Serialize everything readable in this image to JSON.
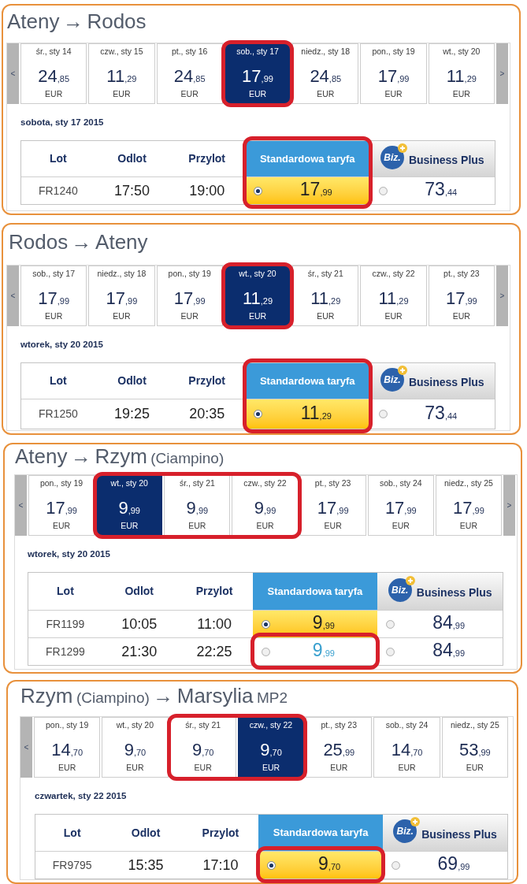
{
  "sections": [
    {
      "title": [
        {
          "text": "Ateny",
          "kind": "main"
        },
        {
          "text": "→",
          "kind": "main"
        },
        {
          "text": "Rodos",
          "kind": "main"
        }
      ],
      "date_strip": {
        "prev": "<",
        "next": ">",
        "dates": [
          {
            "label": "śr., sty 14",
            "whole": "24",
            "decimals": ",85",
            "currency": "EUR",
            "selected": false,
            "circled": false
          },
          {
            "label": "czw., sty 15",
            "whole": "11",
            "decimals": ",29",
            "currency": "EUR",
            "selected": false,
            "circled": false
          },
          {
            "label": "pt., sty 16",
            "whole": "24",
            "decimals": ",85",
            "currency": "EUR",
            "selected": false,
            "circled": false
          },
          {
            "label": "sob., sty 17",
            "whole": "17",
            "decimals": ",99",
            "currency": "EUR",
            "selected": true,
            "circled": true
          },
          {
            "label": "niedz., sty 18",
            "whole": "24",
            "decimals": ",85",
            "currency": "EUR",
            "selected": false,
            "circled": false
          },
          {
            "label": "pon., sty 19",
            "whole": "17",
            "decimals": ",99",
            "currency": "EUR",
            "selected": false,
            "circled": false
          },
          {
            "label": "wt., sty 20",
            "whole": "11",
            "decimals": ",29",
            "currency": "EUR",
            "selected": false,
            "circled": false
          }
        ]
      },
      "date_heading": "sobota, sty 17 2015",
      "table": {
        "columns": [
          {
            "label": "Lot",
            "kind": "plain",
            "circled": false
          },
          {
            "label": "Odlot",
            "kind": "plain",
            "circled": false
          },
          {
            "label": "Przylot",
            "kind": "plain",
            "circled": false
          },
          {
            "label": "Standardowa taryfa",
            "kind": "standard",
            "circled": true
          },
          {
            "label": "Business Plus",
            "kind": "business",
            "logo": "Biz.",
            "circled": false
          }
        ],
        "rows": [
          {
            "flight": "FR1240",
            "departure": "17:50",
            "arrival": "19:00",
            "fares": [
              {
                "whole": "17",
                "decimals": ",99",
                "selected": true,
                "hover": false,
                "circled": false
              },
              {
                "whole": "73",
                "decimals": ",44",
                "selected": false,
                "hover": false,
                "circled": false
              }
            ]
          }
        ]
      }
    },
    {
      "title": [
        {
          "text": "Rodos",
          "kind": "main"
        },
        {
          "text": "→",
          "kind": "main"
        },
        {
          "text": "Ateny",
          "kind": "main"
        }
      ],
      "date_strip": {
        "prev": "<",
        "next": ">",
        "dates": [
          {
            "label": "sob., sty 17",
            "whole": "17",
            "decimals": ",99",
            "currency": "EUR",
            "selected": false,
            "circled": false
          },
          {
            "label": "niedz., sty 18",
            "whole": "17",
            "decimals": ",99",
            "currency": "EUR",
            "selected": false,
            "circled": false
          },
          {
            "label": "pon., sty 19",
            "whole": "17",
            "decimals": ",99",
            "currency": "EUR",
            "selected": false,
            "circled": false
          },
          {
            "label": "wt., sty 20",
            "whole": "11",
            "decimals": ",29",
            "currency": "EUR",
            "selected": true,
            "circled": true
          },
          {
            "label": "śr., sty 21",
            "whole": "11",
            "decimals": ",29",
            "currency": "EUR",
            "selected": false,
            "circled": false
          },
          {
            "label": "czw., sty 22",
            "whole": "11",
            "decimals": ",29",
            "currency": "EUR",
            "selected": false,
            "circled": false
          },
          {
            "label": "pt., sty 23",
            "whole": "17",
            "decimals": ",99",
            "currency": "EUR",
            "selected": false,
            "circled": false
          }
        ]
      },
      "date_heading": "wtorek, sty 20 2015",
      "table": {
        "columns": [
          {
            "label": "Lot",
            "kind": "plain",
            "circled": false
          },
          {
            "label": "Odlot",
            "kind": "plain",
            "circled": false
          },
          {
            "label": "Przylot",
            "kind": "plain",
            "circled": false
          },
          {
            "label": "Standardowa taryfa",
            "kind": "standard",
            "circled": true
          },
          {
            "label": "Business Plus",
            "kind": "business",
            "logo": "Biz.",
            "circled": false
          }
        ],
        "rows": [
          {
            "flight": "FR1250",
            "departure": "19:25",
            "arrival": "20:35",
            "fares": [
              {
                "whole": "11",
                "decimals": ",29",
                "selected": true,
                "hover": false,
                "circled": false
              },
              {
                "whole": "73",
                "decimals": ",44",
                "selected": false,
                "hover": false,
                "circled": false
              }
            ]
          }
        ]
      }
    },
    {
      "title": [
        {
          "text": "Ateny",
          "kind": "main"
        },
        {
          "text": "→",
          "kind": "main"
        },
        {
          "text": "Rzym",
          "kind": "main"
        },
        {
          "text": "(Ciampino)",
          "kind": "note"
        }
      ],
      "date_strip": {
        "prev": "<",
        "next": ">",
        "dates": [
          {
            "label": "pon., sty 19",
            "whole": "17",
            "decimals": ",99",
            "currency": "EUR",
            "selected": false,
            "circled": false
          },
          {
            "label": "wt., sty 20",
            "whole": "9",
            "decimals": ",99",
            "currency": "EUR",
            "selected": true,
            "circled": true
          },
          {
            "label": "śr., sty 21",
            "whole": "9",
            "decimals": ",99",
            "currency": "EUR",
            "selected": false,
            "circled": true
          },
          {
            "label": "czw., sty 22",
            "whole": "9",
            "decimals": ",99",
            "currency": "EUR",
            "selected": false,
            "circled": true
          },
          {
            "label": "pt., sty 23",
            "whole": "17",
            "decimals": ",99",
            "currency": "EUR",
            "selected": false,
            "circled": false
          },
          {
            "label": "sob., sty 24",
            "whole": "17",
            "decimals": ",99",
            "currency": "EUR",
            "selected": false,
            "circled": false
          },
          {
            "label": "niedz., sty 25",
            "whole": "17",
            "decimals": ",99",
            "currency": "EUR",
            "selected": false,
            "circled": false
          }
        ]
      },
      "date_heading": "wtorek, sty 20 2015",
      "table": {
        "columns": [
          {
            "label": "Lot",
            "kind": "plain",
            "circled": false
          },
          {
            "label": "Odlot",
            "kind": "plain",
            "circled": false
          },
          {
            "label": "Przylot",
            "kind": "plain",
            "circled": false
          },
          {
            "label": "Standardowa taryfa",
            "kind": "standard",
            "circled": false
          },
          {
            "label": "Business Plus",
            "kind": "business",
            "logo": "Biz.",
            "circled": false
          }
        ],
        "rows": [
          {
            "flight": "FR1199",
            "departure": "10:05",
            "arrival": "11:00",
            "fares": [
              {
                "whole": "9",
                "decimals": ",99",
                "selected": true,
                "hover": false,
                "circled": false
              },
              {
                "whole": "84",
                "decimals": ",99",
                "selected": false,
                "hover": false,
                "circled": false
              }
            ]
          },
          {
            "flight": "FR1299",
            "departure": "21:30",
            "arrival": "22:25",
            "fares": [
              {
                "whole": "9",
                "decimals": ",99",
                "selected": false,
                "hover": true,
                "circled": true
              },
              {
                "whole": "84",
                "decimals": ",99",
                "selected": false,
                "hover": false,
                "circled": false
              }
            ]
          }
        ]
      }
    },
    {
      "title": [
        {
          "text": "Rzym",
          "kind": "main"
        },
        {
          "text": "(Ciampino)",
          "kind": "note"
        },
        {
          "text": "→",
          "kind": "main"
        },
        {
          "text": "Marsylia",
          "kind": "main"
        },
        {
          "text": "MP2",
          "kind": "note"
        }
      ],
      "date_strip": {
        "prev": "<",
        "dates": [
          {
            "label": "pon., sty 19",
            "whole": "14",
            "decimals": ",70",
            "currency": "EUR",
            "selected": false,
            "circled": false
          },
          {
            "label": "wt., sty 20",
            "whole": "9",
            "decimals": ",70",
            "currency": "EUR",
            "selected": false,
            "circled": false
          },
          {
            "label": "śr., sty 21",
            "whole": "9",
            "decimals": ",70",
            "currency": "EUR",
            "selected": false,
            "circled": true
          },
          {
            "label": "czw., sty 22",
            "whole": "9",
            "decimals": ",70",
            "currency": "EUR",
            "selected": true,
            "circled": true
          },
          {
            "label": "pt., sty 23",
            "whole": "25",
            "decimals": ",99",
            "currency": "EUR",
            "selected": false,
            "circled": false
          },
          {
            "label": "sob., sty 24",
            "whole": "14",
            "decimals": ",70",
            "currency": "EUR",
            "selected": false,
            "circled": false
          },
          {
            "label": "niedz., sty 25",
            "whole": "53",
            "decimals": ",99",
            "currency": "EUR",
            "selected": false,
            "circled": false
          }
        ]
      },
      "date_heading": "czwartek, sty 22 2015",
      "table": {
        "columns": [
          {
            "label": "Lot",
            "kind": "plain",
            "circled": false
          },
          {
            "label": "Odlot",
            "kind": "plain",
            "circled": false
          },
          {
            "label": "Przylot",
            "kind": "plain",
            "circled": false
          },
          {
            "label": "Standardowa taryfa",
            "kind": "standard",
            "circled": false
          },
          {
            "label": "Business Plus",
            "kind": "business",
            "logo": "Biz.",
            "circled": false
          }
        ],
        "rows": [
          {
            "flight": "FR9795",
            "departure": "15:35",
            "arrival": "17:10",
            "fares": [
              {
                "whole": "9",
                "decimals": ",70",
                "selected": true,
                "hover": false,
                "circled": true
              },
              {
                "whole": "69",
                "decimals": ",99",
                "selected": false,
                "hover": false,
                "circled": false
              }
            ]
          }
        ]
      }
    }
  ]
}
